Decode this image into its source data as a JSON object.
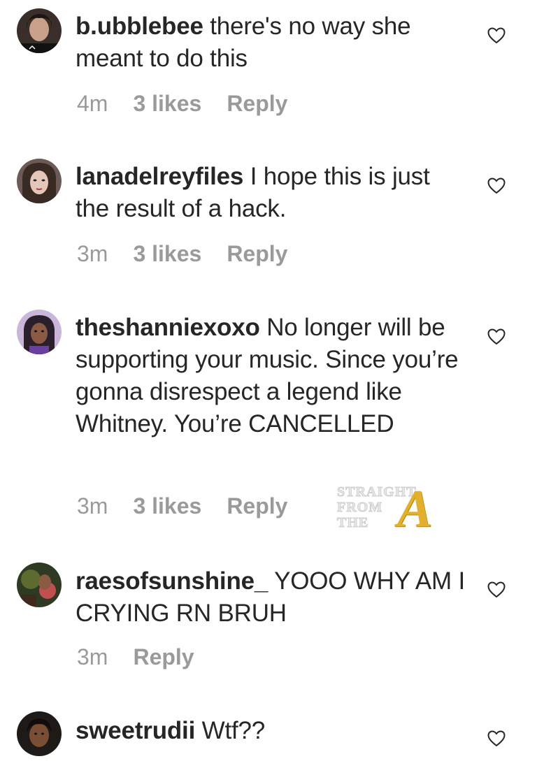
{
  "comments": [
    {
      "username": "b.ubblebee",
      "text": "there's no way she meant to do this",
      "time": "4m",
      "likes": "3 likes",
      "reply": "Reply",
      "avatar": "avatar-b-ubblebee"
    },
    {
      "username": "lanadelreyfiles",
      "text": "I hope this is just the result of a hack.",
      "time": "3m",
      "likes": "3 likes",
      "reply": "Reply",
      "avatar": "avatar-lanadelreyfiles"
    },
    {
      "username": "theshanniexoxo",
      "text": "No longer will be supporting your music. Since you’re gonna disrespect a legend like Whitney. You’re CANCELLED",
      "time": "3m",
      "likes": "3 likes",
      "reply": "Reply",
      "avatar": "avatar-theshanniexoxo"
    },
    {
      "username": "raesofsunshine_",
      "text": "YOOO WHY AM I CRYING RN BRUH",
      "time": "3m",
      "likes": "",
      "reply": "Reply",
      "avatar": "avatar-raesofsunshine"
    },
    {
      "username": "sweetrudii",
      "text": "Wtf??",
      "time": "",
      "likes": "",
      "reply": "",
      "avatar": "avatar-sweetrudii"
    }
  ],
  "watermark": {
    "line1": "STRAIGHT",
    "line2": "FROM",
    "line3": "THE",
    "letter": "A"
  },
  "icons": {
    "like": "heart-outline-icon"
  },
  "colors": {
    "text": "#262626",
    "meta": "#999999",
    "watermark_gold": "#e2b02e"
  }
}
